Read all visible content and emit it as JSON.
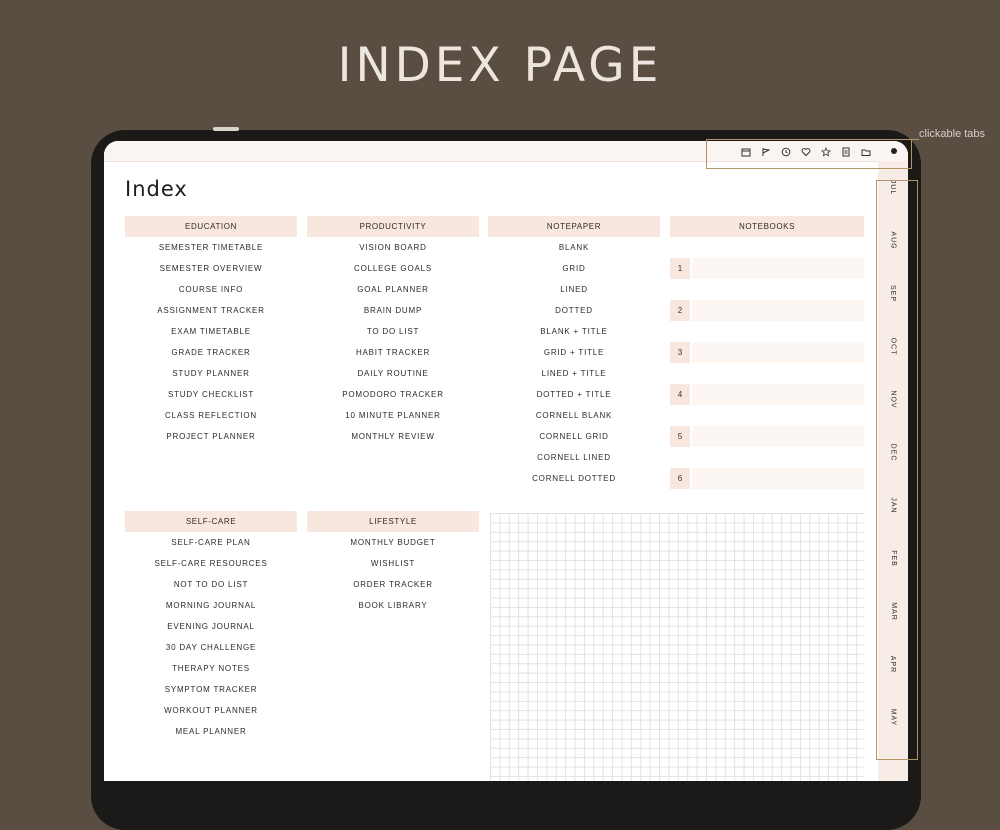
{
  "headline": "INDEX PAGE",
  "callout": "clickable tabs",
  "page_title": "Index",
  "topbar_icons": [
    "calendar-icon",
    "flag-icon",
    "clock-icon",
    "heart-icon",
    "star-icon",
    "notes-icon",
    "folder-icon"
  ],
  "columns": {
    "education": {
      "header": "EDUCATION",
      "items": [
        "SEMESTER TIMETABLE",
        "SEMESTER OVERVIEW",
        "COURSE INFO",
        "ASSIGNMENT TRACKER",
        "EXAM TIMETABLE",
        "GRADE TRACKER",
        "STUDY PLANNER",
        "STUDY CHECKLIST",
        "CLASS REFLECTION",
        "PROJECT PLANNER"
      ]
    },
    "productivity": {
      "header": "PRODUCTIVITY",
      "items": [
        "VISION BOARD",
        "COLLEGE GOALS",
        "GOAL PLANNER",
        "BRAIN DUMP",
        "TO DO LIST",
        "HABIT TRACKER",
        "DAILY ROUTINE",
        "POMODORO TRACKER",
        "10 MINUTE PLANNER",
        "MONTHLY REVIEW"
      ]
    },
    "notepaper": {
      "header": "NOTEPAPER",
      "items": [
        "BLANK",
        "GRID",
        "LINED",
        "DOTTED",
        "BLANK + TITLE",
        "GRID + TITLE",
        "LINED + TITLE",
        "DOTTED + TITLE",
        "CORNELL BLANK",
        "CORNELL GRID",
        "CORNELL LINED",
        "CORNELL DOTTED"
      ]
    },
    "notebooks": {
      "header": "NOTEBOOKS",
      "items": [
        "1",
        "2",
        "3",
        "4",
        "5",
        "6"
      ]
    },
    "selfcare": {
      "header": "SELF-CARE",
      "items": [
        "SELF-CARE PLAN",
        "SELF-CARE RESOURCES",
        "NOT TO DO LIST",
        "MORNING JOURNAL",
        "EVENING JOURNAL",
        "30 DAY CHALLENGE",
        "THERAPY NOTES",
        "SYMPTOM TRACKER",
        "WORKOUT PLANNER",
        "MEAL PLANNER"
      ]
    },
    "lifestyle": {
      "header": "LIFESTYLE",
      "items": [
        "MONTHLY BUDGET",
        "WISHLIST",
        "ORDER TRACKER",
        "BOOK LIBRARY"
      ]
    }
  },
  "month_tabs": [
    "JUL",
    "AUG",
    "SEP",
    "OCT",
    "NOV",
    "DEC",
    "JAN",
    "FEB",
    "MAR",
    "APR",
    "MAY"
  ],
  "colors": {
    "background": "#5a4d42",
    "header_fill": "#f8e7df",
    "accent_outline": "#b59468"
  }
}
